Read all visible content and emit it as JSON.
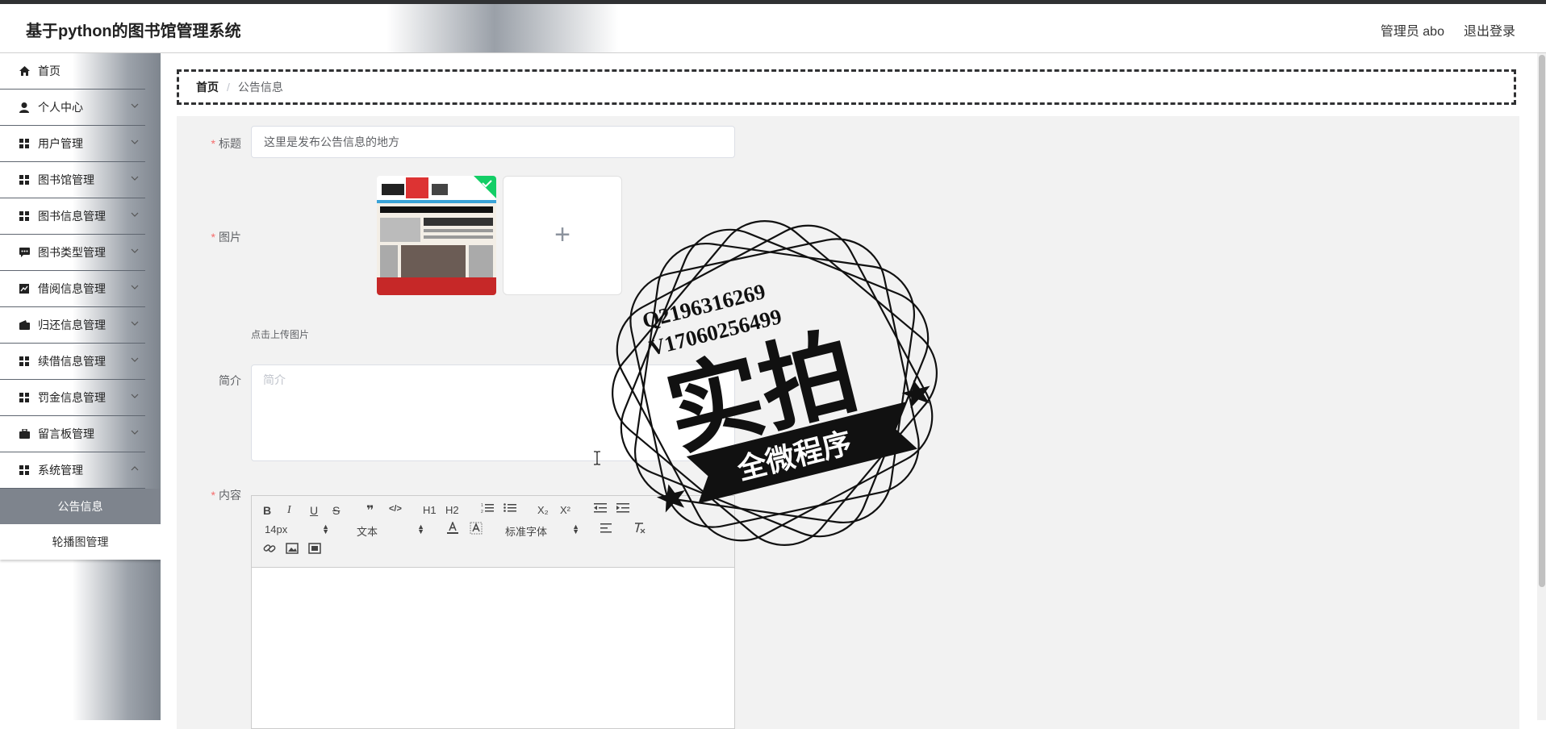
{
  "header": {
    "app_title": "基于python的图书馆管理系统",
    "user_label": "管理员 abo",
    "logout_label": "退出登录"
  },
  "sidebar": {
    "items": [
      {
        "label": "首页",
        "icon": "home-icon",
        "has_arrow": false
      },
      {
        "label": "个人中心",
        "icon": "user-icon",
        "has_arrow": true
      },
      {
        "label": "用户管理",
        "icon": "grid-icon",
        "has_arrow": true
      },
      {
        "label": "图书馆管理",
        "icon": "grid-icon",
        "has_arrow": true
      },
      {
        "label": "图书信息管理",
        "icon": "grid-icon",
        "has_arrow": true
      },
      {
        "label": "图书类型管理",
        "icon": "comment-icon",
        "has_arrow": true
      },
      {
        "label": "借阅信息管理",
        "icon": "chart-icon",
        "has_arrow": true
      },
      {
        "label": "归还信息管理",
        "icon": "wallet-icon",
        "has_arrow": true
      },
      {
        "label": "续借信息管理",
        "icon": "grid-icon",
        "has_arrow": true
      },
      {
        "label": "罚金信息管理",
        "icon": "grid-icon",
        "has_arrow": true
      },
      {
        "label": "留言板管理",
        "icon": "briefcase-icon",
        "has_arrow": true
      },
      {
        "label": "系统管理",
        "icon": "grid-icon",
        "has_arrow": true
      }
    ],
    "subitems": [
      {
        "label": "公告信息",
        "active": true
      },
      {
        "label": "轮播图管理",
        "active": false
      }
    ]
  },
  "breadcrumb": {
    "home": "首页",
    "separator": "/",
    "current": "公告信息"
  },
  "form": {
    "title_label": "标题",
    "title_value": "这里是发布公告信息的地方",
    "image_label": "图片",
    "upload_plus": "+",
    "upload_tip": "点击上传图片",
    "intro_label": "简介",
    "intro_placeholder": "简介",
    "content_label": "内容",
    "required_mark": "*"
  },
  "editor": {
    "font_size": "14px",
    "paragraph": "文本",
    "font_family": "标准字体",
    "buttons": {
      "bold": "B",
      "italic": "I",
      "underline": "U",
      "strike": "S",
      "quote": "❞",
      "code": "</>",
      "h1": "H1",
      "h2": "H2",
      "sub": "X₂",
      "sup": "X²"
    }
  },
  "watermark": {
    "line1": "Q2196316269",
    "line2": "V17060256499",
    "big": "实拍",
    "banner": "全微程序"
  },
  "colors": {
    "accent_gray": "#7e848d",
    "required_red": "#f56c6c",
    "topbar": "#303133"
  }
}
